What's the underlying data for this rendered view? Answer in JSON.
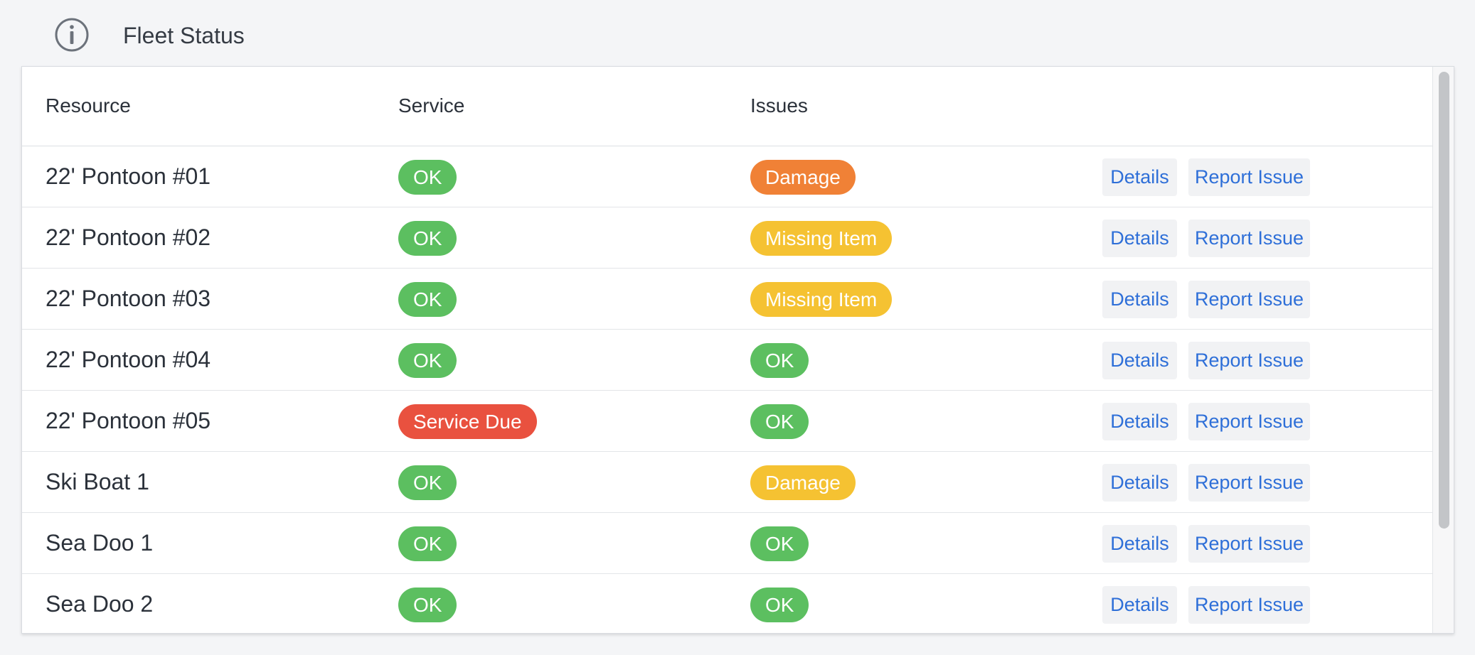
{
  "header": {
    "title": "Fleet Status",
    "icon": "info-icon"
  },
  "table": {
    "columns": [
      "Resource",
      "Service",
      "Issues"
    ],
    "rows": [
      {
        "resource": "22' Pontoon #01",
        "service": "OK",
        "issues": "Damage",
        "details": "Details",
        "report": "Report Issue"
      },
      {
        "resource": "22' Pontoon #02",
        "service": "OK",
        "issues": "Missing Item",
        "details": "Details",
        "report": "Report Issue"
      },
      {
        "resource": "22' Pontoon #03",
        "service": "OK",
        "issues": "Missing Item",
        "details": "Details",
        "report": "Report Issue"
      },
      {
        "resource": "22' Pontoon #04",
        "service": "OK",
        "issues": "OK",
        "details": "Details",
        "report": "Report Issue"
      },
      {
        "resource": "22' Pontoon #05",
        "service": "Service Due",
        "issues": "OK",
        "details": "Details",
        "report": "Report Issue"
      },
      {
        "resource": "Ski Boat 1",
        "service": "OK",
        "issues": "Damage",
        "details": "Details",
        "report": "Report Issue"
      },
      {
        "resource": "Sea Doo 1",
        "service": "OK",
        "issues": "OK",
        "details": "Details",
        "report": "Report Issue"
      },
      {
        "resource": "Sea Doo 2",
        "service": "OK",
        "issues": "OK",
        "details": "Details",
        "report": "Report Issue"
      }
    ]
  },
  "badge_colors": {
    "ok": "#5cbf60",
    "service_due": "#e9513f",
    "damage_orange": "#f08136",
    "warning_yellow": "#f5c232"
  },
  "link_color": "#2e6fd8"
}
